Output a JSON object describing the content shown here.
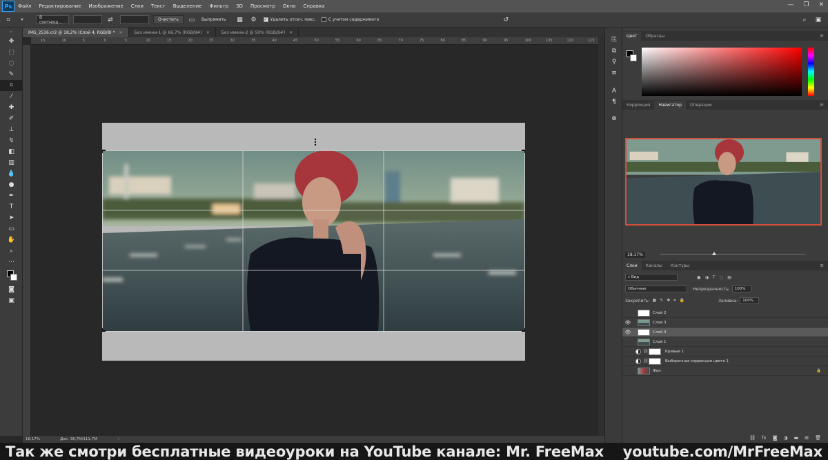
{
  "menubar": {
    "logo": "Ps",
    "items": [
      "Файл",
      "Редактирование",
      "Изображение",
      "Слои",
      "Текст",
      "Выделение",
      "Фильтр",
      "3D",
      "Просмотр",
      "Окно",
      "Справка"
    ]
  },
  "options": {
    "ratio_select": "В соотнош...",
    "clear_label": "Очистить",
    "straighten_label": "Выпрямить",
    "delete_cropped_label": "Удалить отсеч. пикс.",
    "content_aware_label": "С учетом содержимого"
  },
  "doc_tabs": [
    {
      "label": "IMG_2536.cr2 @ 18,2% (Слой 4, RGB/8) *",
      "active": true
    },
    {
      "label": "Без имени-1 @ 66,7% (RGB/8#)",
      "active": false
    },
    {
      "label": "Без имени-2 @ 50% (RGB/8#)",
      "active": false
    }
  ],
  "ruler_labels": [
    "15",
    "10",
    "5",
    "0",
    "5",
    "10",
    "15",
    "20",
    "25",
    "30",
    "35",
    "40",
    "45",
    "50",
    "55",
    "60",
    "65",
    "70",
    "75",
    "80",
    "85",
    "90",
    "95",
    "100",
    "105",
    "110",
    "115"
  ],
  "status": {
    "zoom": "18,17%",
    "doc": "Док: 36,7M/111,7M"
  },
  "color_panel": {
    "tabs": [
      "Цвет",
      "Образцы"
    ],
    "fg_color": "#000000",
    "bg_color": "#ffffff"
  },
  "nav_panel": {
    "tabs": [
      "Коррекция",
      "Навигатор",
      "Операции"
    ],
    "zoom": "18,17%"
  },
  "layers_panel": {
    "tabs": [
      "Слои",
      "Каналы",
      "Контуры"
    ],
    "kind_filter": "Вид",
    "blend_mode": "Обычные",
    "opacity_label": "Непрозрачность:",
    "opacity_value": "100%",
    "lock_label": "Закрепить:",
    "fill_label": "Заливка:",
    "fill_value": "100%",
    "layers": [
      {
        "name": "Слой 2",
        "visible": false,
        "type": "white"
      },
      {
        "name": "Слой 3",
        "visible": true,
        "type": "photo"
      },
      {
        "name": "Слой 4",
        "visible": true,
        "type": "white",
        "selected": true
      },
      {
        "name": "Слой 1",
        "visible": false,
        "type": "photo"
      },
      {
        "name": "Кривые 1",
        "visible": false,
        "type": "adjustment"
      },
      {
        "name": "Выборочная коррекция цвета 1",
        "visible": false,
        "type": "adjustment"
      },
      {
        "name": "Фон",
        "visible": false,
        "type": "background"
      }
    ]
  },
  "watermark": {
    "left": "Так же смотри бесплатные видеоуроки на YouTube канале: Mr. FreeMax",
    "right": "youtube.com/MrFreeMax"
  }
}
